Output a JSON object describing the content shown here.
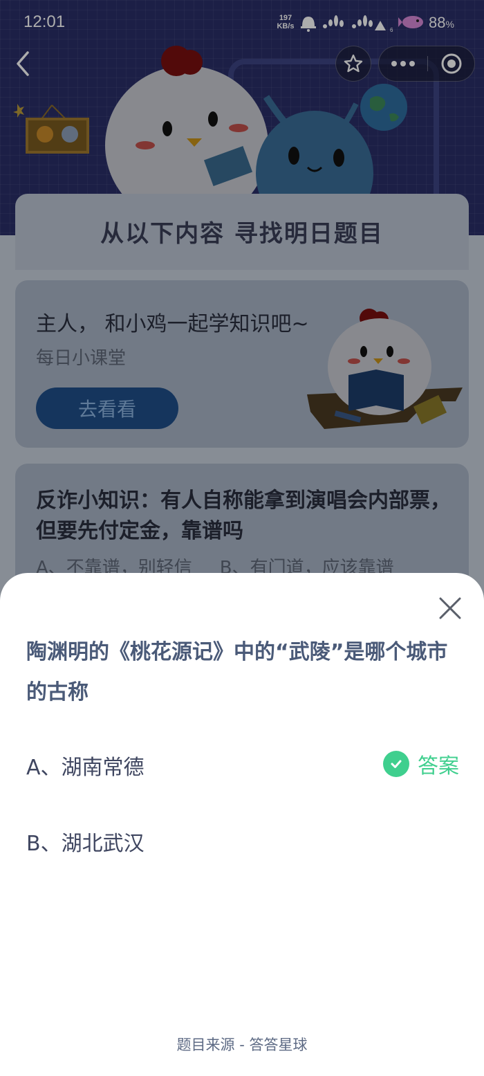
{
  "status_bar": {
    "time": "12:01",
    "net_speed_value": "197",
    "net_speed_unit": "KB/s",
    "battery": "88",
    "battery_unit": "%",
    "icons": [
      "bell-icon",
      "signal-icon",
      "signal-icon",
      "wifi-icon",
      "fish-icon"
    ]
  },
  "nav": {
    "back_icon": "chevron-left-icon",
    "star_icon": "star-icon",
    "more_icon": "ellipsis-icon",
    "close_icon": "target-icon"
  },
  "background": {
    "banner_title": "从以下内容 寻找明日题目",
    "card1": {
      "title": "主人， 和小鸡一起学知识吧~",
      "subtitle": "每日小课堂",
      "button": "去看看"
    },
    "card2": {
      "title": "反诈小知识：有人自称能拿到演唱会内部票，但要先付定金，靠谱吗",
      "option_a": "A、不靠谱，别轻信",
      "option_b": "B、有门道，应该靠谱"
    }
  },
  "sheet": {
    "question": "陶渊明的《桃花源记》中的“武陵”是哪个城市的古称",
    "options": [
      {
        "label": "A、湖南常德",
        "is_answer": true
      },
      {
        "label": "B、湖北武汉",
        "is_answer": false
      }
    ],
    "answer_tag": "答案",
    "footer": "题目来源 - 答答星球"
  },
  "colors": {
    "accent_green": "#3fcf8e",
    "question_text": "#4a5a78",
    "hero_bg": "#2a2f68"
  }
}
